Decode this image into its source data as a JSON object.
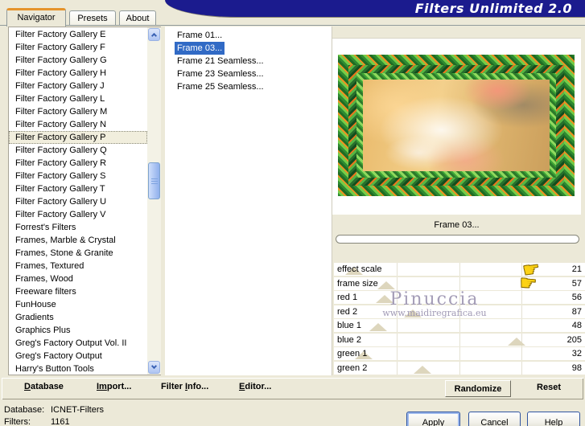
{
  "window": {
    "title": "Filters Unlimited 2.0"
  },
  "tabs": [
    {
      "label": "Navigator",
      "active": true
    },
    {
      "label": "Presets",
      "active": false
    },
    {
      "label": "About",
      "active": false
    }
  ],
  "category_list": {
    "items": [
      "Filter Factory Gallery E",
      "Filter Factory Gallery F",
      "Filter Factory Gallery G",
      "Filter Factory Gallery H",
      "Filter Factory Gallery J",
      "Filter Factory Gallery L",
      "Filter Factory Gallery M",
      "Filter Factory Gallery N",
      "Filter Factory Gallery P",
      "Filter Factory Gallery Q",
      "Filter Factory Gallery R",
      "Filter Factory Gallery S",
      "Filter Factory Gallery T",
      "Filter Factory Gallery U",
      "Filter Factory Gallery V",
      "Forrest's Filters",
      "Frames, Marble & Crystal",
      "Frames, Stone & Granite",
      "Frames, Textured",
      "Frames, Wood",
      "Freeware filters",
      "FunHouse",
      "Gradients",
      "Graphics Plus",
      "Greg's Factory Output Vol. II",
      "Greg's Factory Output",
      "Harry's Button Tools"
    ],
    "selected": "Filter Factory Gallery P"
  },
  "filter_list": {
    "items": [
      "Frame 01...",
      "Frame 03...",
      "Frame 21 Seamless...",
      "Frame 23 Seamless...",
      "Frame 25 Seamless..."
    ],
    "selected": "Frame 03..."
  },
  "preview": {
    "caption": "Frame 03...",
    "progress_percent": 0
  },
  "sliders": {
    "max": 255,
    "rows": [
      {
        "label": "effect scale",
        "value": 21
      },
      {
        "label": "frame size",
        "value": 57
      },
      {
        "label": "red 1",
        "value": 56
      },
      {
        "label": "red 2",
        "value": 87
      },
      {
        "label": "blue 1",
        "value": 48
      },
      {
        "label": "blue 2",
        "value": 205
      },
      {
        "label": "green 1",
        "value": 32
      },
      {
        "label": "green 2",
        "value": 98
      }
    ]
  },
  "watermark": {
    "line1": "Pinuccia",
    "line2": "www.maidiregrafica.eu"
  },
  "menu_buttons": [
    {
      "pre": "",
      "accel": "D",
      "post": "atabase"
    },
    {
      "pre": "",
      "accel": "Im",
      "post": "port..."
    },
    {
      "pre": "Filter ",
      "accel": "I",
      "post": "nfo..."
    },
    {
      "pre": "",
      "accel": "E",
      "post": "ditor..."
    }
  ],
  "action_buttons": {
    "randomize": "Randomize",
    "reset": "Reset",
    "apply": "Apply",
    "cancel": "Cancel",
    "help": "Help"
  },
  "status": {
    "line1_label": "Database:",
    "line1_value": "ICNET-Filters",
    "line2_label": "Filters:",
    "line2_value": "1161"
  },
  "colors": {
    "selection_blue": "#316ac5",
    "banner_navy": "#1b1b8e",
    "tab_accent_orange": "#e5942c",
    "dialog_beige": "#ece9d8",
    "hand_yellow": "#fcd215"
  }
}
